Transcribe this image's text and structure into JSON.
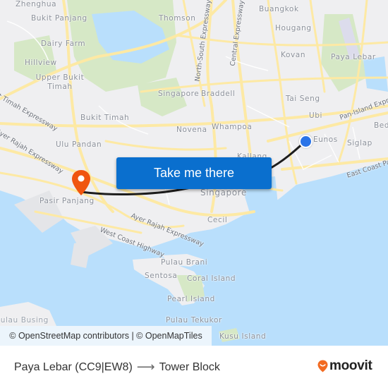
{
  "map": {
    "places": [
      {
        "name": "Zhenghua"
      },
      {
        "name": "Bukit Panjang"
      },
      {
        "name": "Thomson"
      },
      {
        "name": "Buangkok"
      },
      {
        "name": "Hougang"
      },
      {
        "name": "Dairy Farm"
      },
      {
        "name": "Kovan"
      },
      {
        "name": "Paya Lebar"
      },
      {
        "name": "Hillview"
      },
      {
        "name": "Upper Bukit Timah"
      },
      {
        "name": "Singapore"
      },
      {
        "name": "Braddell"
      },
      {
        "name": "Tai Seng"
      },
      {
        "name": "Ubi"
      },
      {
        "name": "Bukit Timah"
      },
      {
        "name": "Novena"
      },
      {
        "name": "Whampoa"
      },
      {
        "name": "Eunos"
      },
      {
        "name": "Bedok"
      },
      {
        "name": "Siglap"
      },
      {
        "name": "Ulu Pandan"
      },
      {
        "name": "Kallang"
      },
      {
        "name": "Singapore"
      },
      {
        "name": "Pasir Panjang"
      },
      {
        "name": "Cecil"
      },
      {
        "name": "Pulau Brani"
      },
      {
        "name": "Sentosa"
      },
      {
        "name": "Coral Island"
      },
      {
        "name": "Pearl Island"
      },
      {
        "name": "Pulau Busing"
      },
      {
        "name": "Pulau Tekukor"
      },
      {
        "name": "Kusu Island"
      }
    ],
    "roads": [
      {
        "name": "North-South Expressway"
      },
      {
        "name": "Central Expressway"
      },
      {
        "name": "Bukit Timah Expressway"
      },
      {
        "name": "Ayer Rajah Expressway"
      },
      {
        "name": "Ayer Rajah Expressway"
      },
      {
        "name": "West Coast Highway"
      },
      {
        "name": "Pan-Island Expressway"
      },
      {
        "name": "East Coast Parkway"
      }
    ],
    "attribution": "© OpenStreetMap contributors | © OpenMapTiles",
    "cta_label": "Take me there",
    "colors": {
      "water": "#b9dffc",
      "land": "#efeff1",
      "park": "#d6e8c6",
      "road": "#fdeeb0",
      "route": "#1d1d1d",
      "cta": "#0a6fce",
      "origin": "#2b74e8",
      "destination": "#f0550f",
      "brand": "#f26a21"
    }
  },
  "footer": {
    "origin": "Paya Lebar (CC9|EW8)",
    "arrow": "⟶",
    "destination": "Tower Block",
    "brand": "moovit"
  }
}
